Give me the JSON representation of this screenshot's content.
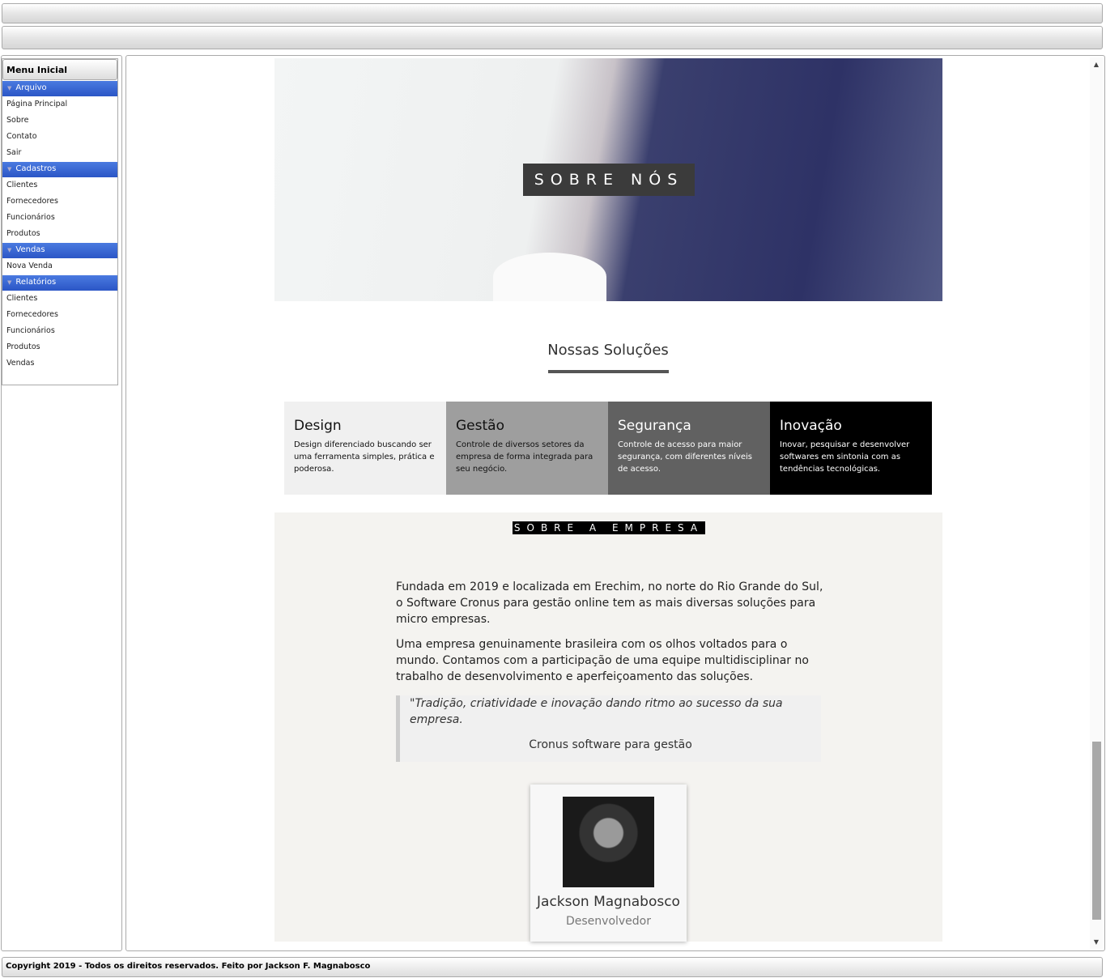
{
  "sidebar": {
    "title": "Menu Inicial",
    "groups": [
      {
        "label": "Arquivo",
        "items": [
          "Página Principal",
          "Sobre",
          "Contato",
          "Sair"
        ]
      },
      {
        "label": "Cadastros",
        "items": [
          "Clientes",
          "Fornecedores",
          "Funcionários",
          "Produtos"
        ]
      },
      {
        "label": "Vendas",
        "items": [
          "Nova Venda"
        ]
      },
      {
        "label": "Relatórios",
        "items": [
          "Clientes",
          "Fornecedores",
          "Funcionários",
          "Produtos",
          "Vendas"
        ]
      }
    ]
  },
  "hero": {
    "title": "SOBRE NÓS"
  },
  "solutions": {
    "title": "Nossas Soluções",
    "cards": [
      {
        "title": "Design",
        "text": "Design diferenciado buscando ser uma ferramenta simples, prática e poderosa.",
        "bg": "#f0f0f0",
        "fg": "#111111"
      },
      {
        "title": "Gestão",
        "text": "Controle de diversos setores da empresa de forma integrada para seu negócio.",
        "bg": "#9e9e9e",
        "fg": "#111111"
      },
      {
        "title": "Segurança",
        "text": "Controle de acesso para maior segurança, com diferentes níveis de acesso.",
        "bg": "#616161",
        "fg": "#ffffff"
      },
      {
        "title": "Inovação",
        "text": "Inovar, pesquisar e desenvolver softwares em sintonia com as tendências tecnológicas.",
        "bg": "#000000",
        "fg": "#ffffff"
      }
    ]
  },
  "about": {
    "label": "SOBRE A EMPRESA",
    "p1": "Fundada em 2019 e localizada em Erechim, no norte do Rio Grande do Sul, o Software Cronus para gestão online tem as mais diversas soluções para micro empresas.",
    "p2": "Uma empresa genuinamente brasileira com os olhos voltados para o mundo. Contamos com a participação de uma equipe multidisciplinar no trabalho de desenvolvimento e aperfeiçoamento das soluções.",
    "quote": "\"Tradição, criatividade e inovação dando ritmo ao sucesso da sua empresa.",
    "quote_source": "Cronus software para gestão",
    "profile": {
      "name": "Jackson Magnabosco",
      "role": "Desenvolvedor"
    }
  },
  "footer": {
    "text": "Copyright 2019 - Todos os direitos reservados. Feito por Jackson F. Magnabosco"
  }
}
